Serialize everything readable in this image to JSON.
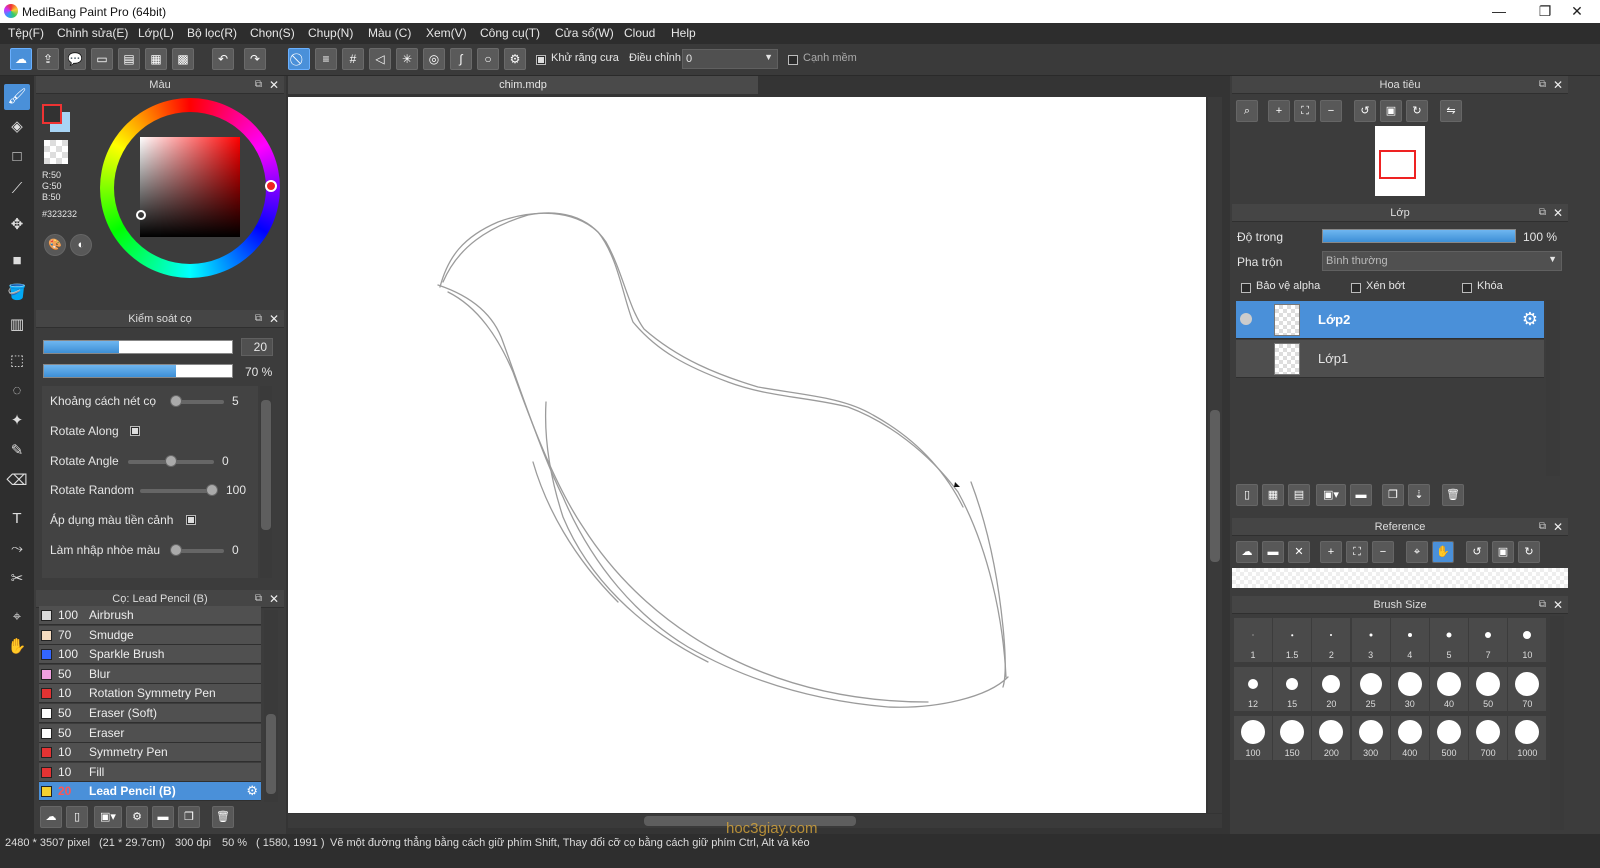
{
  "titlebar": {
    "title": "MediBang Paint Pro (64bit)",
    "minimize": "—",
    "maximize": "❐",
    "close": "✕"
  },
  "menu": [
    "Tệp(F)",
    "Chỉnh sửa(E)",
    "Lớp(L)",
    "Bộ lọc(R)",
    "Chọn(S)",
    "Chụp(N)",
    "Màu (C)",
    "Xem(V)",
    "Công cụ(T)",
    "Cửa sổ(W)",
    "Cloud",
    "Help"
  ],
  "toolbar": {
    "antialias_label": "Khử răng cưa",
    "adjust_label": "Điều chỉnh",
    "adjust_value": "0",
    "soft_edge_label": "Cạnh mềm"
  },
  "canvas": {
    "tab_title": "chim.mdp"
  },
  "color_panel": {
    "title": "Màu",
    "rgb": {
      "r": "R:50",
      "g": "G:50",
      "b": "B:50"
    },
    "hex": "#323232",
    "fg_color": "#323232",
    "bg_color": "#a8d4f5"
  },
  "brush_control": {
    "title": "Kiểm soát cọ",
    "size_value": "20",
    "size_fraction": 0.4,
    "opacity_value": "70 %",
    "opacity_fraction": 0.7,
    "rows": [
      {
        "label": "Khoảng cách nét cọ",
        "value": "5",
        "type": "slider",
        "level": 0.0
      },
      {
        "label": "Rotate Along",
        "type": "check",
        "checked": true
      },
      {
        "label": "Rotate Angle",
        "value": "0",
        "type": "slider",
        "level": 0.5
      },
      {
        "label": "Rotate Random",
        "value": "100",
        "type": "slider",
        "level": 1.0
      },
      {
        "label": "Áp dụng màu tiền cảnh",
        "type": "check",
        "checked": true
      },
      {
        "label": "Làm nhập nhòe màu",
        "value": "0",
        "type": "slider",
        "level": 0.0
      }
    ]
  },
  "brush_list": {
    "title": "Cọ: Lead Pencil (B)",
    "items": [
      {
        "size": "100",
        "name": "Airbrush",
        "color": "#d9d9d9"
      },
      {
        "size": "70",
        "name": "Smudge",
        "color": "#f5dcc0"
      },
      {
        "size": "100",
        "name": "Sparkle Brush",
        "color": "#3366ff"
      },
      {
        "size": "50",
        "name": "Blur",
        "color": "#f0a0e0"
      },
      {
        "size": "10",
        "name": "Rotation Symmetry Pen",
        "color": "#e33333"
      },
      {
        "size": "50",
        "name": "Eraser (Soft)",
        "color": "#ffffff"
      },
      {
        "size": "50",
        "name": "Eraser",
        "color": "#ffffff"
      },
      {
        "size": "10",
        "name": "Symmetry Pen",
        "color": "#e33333"
      },
      {
        "size": "10",
        "name": "Fill",
        "color": "#e33333"
      },
      {
        "size": "20",
        "name": "Lead Pencil (B)",
        "color": "#f5d130",
        "selected": true
      }
    ]
  },
  "navigator": {
    "title": "Hoa tiêu"
  },
  "layer_panel": {
    "title": "Lớp",
    "opacity_label": "Độ trong",
    "opacity_value": "100 %",
    "opacity_fraction": 1.0,
    "blend_label": "Pha trộn",
    "blend_value": "Bình thường",
    "protect_alpha": "Bảo vệ alpha",
    "clipping": "Xén bớt",
    "lock": "Khóa",
    "layers": [
      {
        "name": "Lớp2",
        "selected": true
      },
      {
        "name": "Lớp1",
        "selected": false
      }
    ]
  },
  "reference_panel": {
    "title": "Reference"
  },
  "brush_size_panel": {
    "title": "Brush Size",
    "sizes": [
      "1",
      "1.5",
      "2",
      "3",
      "4",
      "5",
      "7",
      "10",
      "12",
      "15",
      "20",
      "25",
      "30",
      "40",
      "50",
      "70",
      "100",
      "150",
      "200",
      "300",
      "400",
      "500",
      "700",
      "1000"
    ]
  },
  "status": {
    "dims": "2480 * 3507 pixel",
    "cm": "(21 * 29.7cm)",
    "dpi": "300 dpi",
    "zoom": "50 %",
    "coords": "( 1580, 1991 )",
    "hint": "Vẽ một đường thẳng bằng cách giữ phím Shift, Thay đổi cỡ cọ bằng cách giữ phím Ctrl, Alt và kéo",
    "watermark": "hoc3giay.com"
  }
}
